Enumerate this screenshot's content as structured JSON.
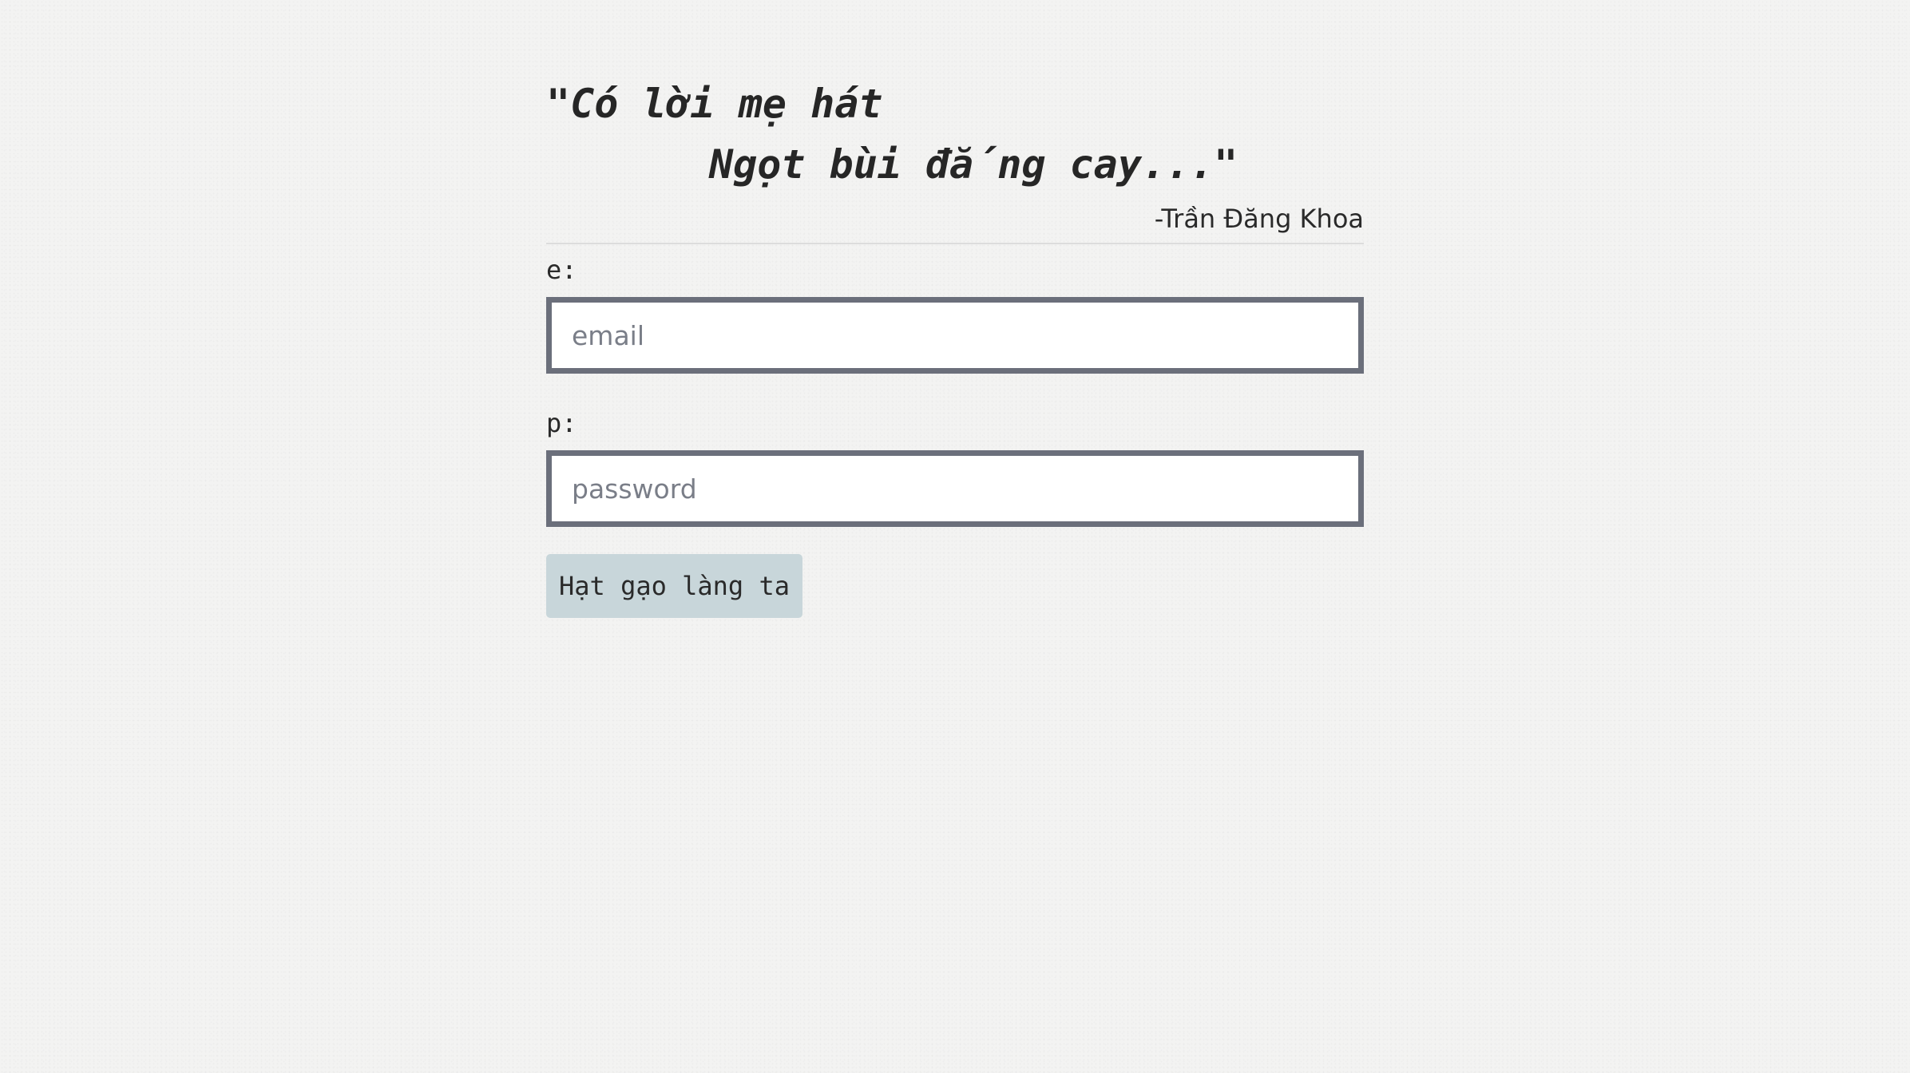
{
  "quote": {
    "line1": "\"Có lời mẹ hát",
    "line2": "Ngọt bùi đắng cay...\"",
    "author": "-Trần Đăng Khoa"
  },
  "form": {
    "email_label": "e:",
    "email_placeholder": "email",
    "password_label": "p:",
    "password_placeholder": "password",
    "submit_label": "Hạt gạo làng ta"
  },
  "colors": {
    "background": "#f3f3f2",
    "input_border": "#6b6f7b",
    "button_bg": "#c8d6da"
  }
}
